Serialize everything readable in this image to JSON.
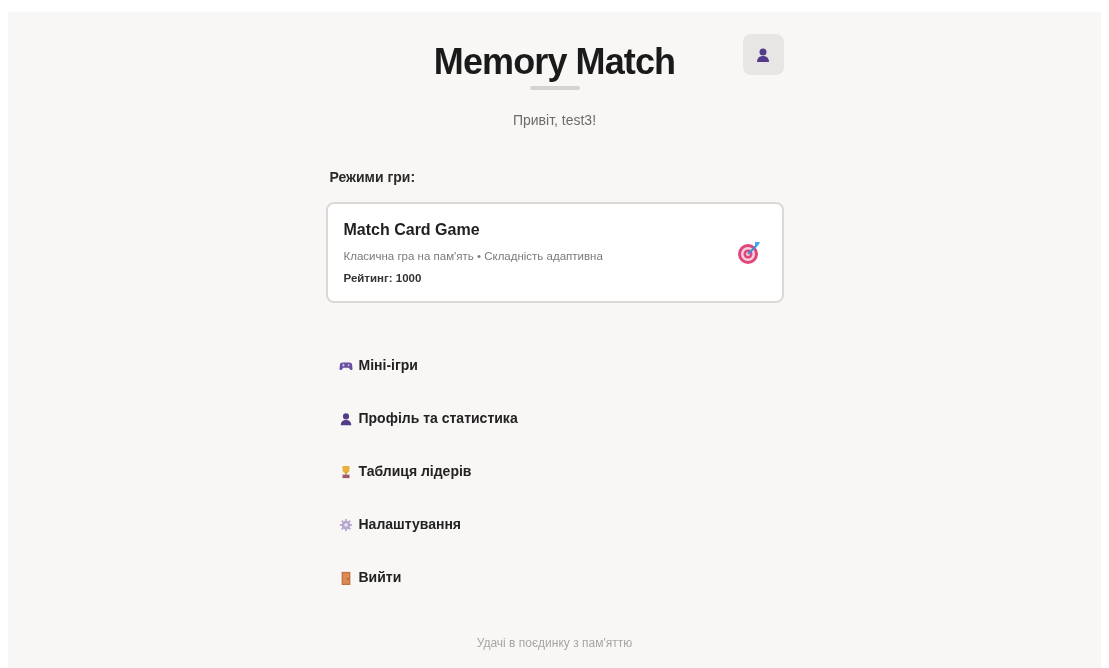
{
  "header": {
    "title": "Memory Match",
    "greeting": "Привіт, test3!"
  },
  "modes": {
    "heading": "Режими гри:",
    "cards": [
      {
        "title": "Match Card Game",
        "description": "Класична гра на пам'ять • Складність адаптивна",
        "rating": "Рейтинг: 1000"
      }
    ]
  },
  "menu": [
    {
      "label": "Міні-ігри",
      "kind": "games"
    },
    {
      "label": "Профіль та статистика",
      "kind": "profile"
    },
    {
      "label": "Таблиця лідерів",
      "kind": "leaderboard"
    },
    {
      "label": "Налаштування",
      "kind": "settings"
    },
    {
      "label": "Вийти",
      "kind": "logout"
    }
  ],
  "footer": "Удачі в поєдинку з пам'яттю"
}
